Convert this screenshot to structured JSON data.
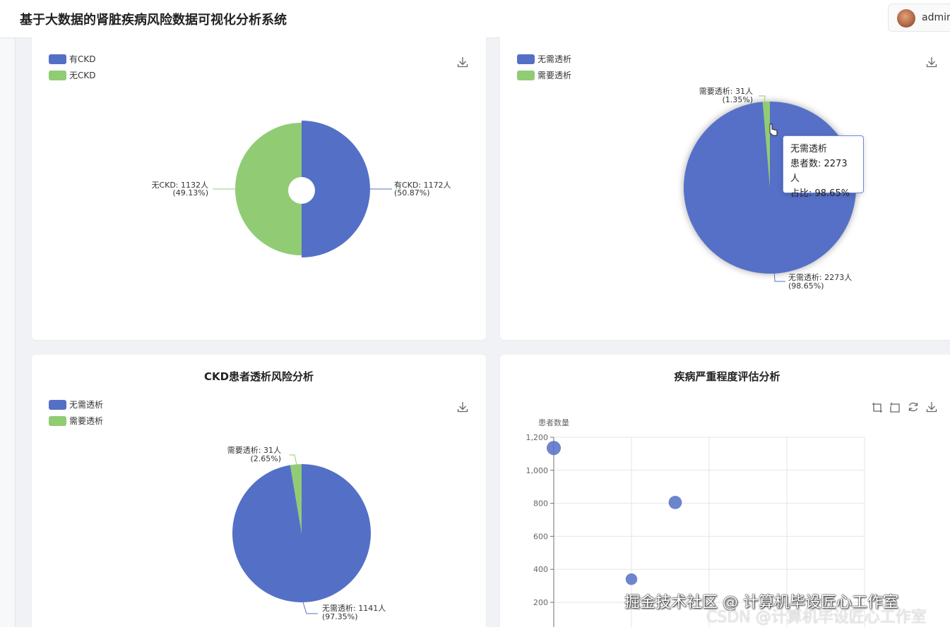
{
  "header": {
    "title": "基于大数据的肾脏疾病风险数据可视化分析系统",
    "username": "admin"
  },
  "watermark": {
    "main": "掘金技术社区 @ 计算机毕设匠心工作室",
    "sub": "CSDN @计算机毕设匠心工作室"
  },
  "colors": {
    "blue": "#5470c6",
    "green": "#91cc75"
  },
  "icons": {
    "download": "download-icon",
    "zoom": "zoom-icon",
    "zoom_back": "zoom-back-icon",
    "restore": "restore-icon"
  },
  "chart_data": [
    {
      "type": "pie",
      "variant": "rose-donut",
      "legend": [
        "有CKD",
        "无CKD"
      ],
      "legend_position": "top-left",
      "slices": [
        {
          "name": "有CKD",
          "value": 1172,
          "label": "有CKD: 1172人",
          "pct_label": "(50.87%)",
          "color": "#5470c6"
        },
        {
          "name": "无CKD",
          "value": 1132,
          "label": "无CKD: 1132人",
          "pct_label": "(49.13%)",
          "color": "#91cc75"
        }
      ]
    },
    {
      "type": "pie",
      "legend": [
        "无需透析",
        "需要透析"
      ],
      "legend_position": "top-left",
      "slices": [
        {
          "name": "无需透析",
          "value": 2273,
          "label": "无需透析: 2273人",
          "pct_label": "(98.65%)",
          "color": "#5470c6"
        },
        {
          "name": "需要透析",
          "value": 31,
          "label": "需要透析: 31人",
          "pct_label": "(1.35%)",
          "color": "#91cc75"
        }
      ],
      "tooltip": {
        "name": "无需透析",
        "count": "患者数: 2273人",
        "ratio": "占比: 98.65%"
      }
    },
    {
      "type": "pie",
      "title": "CKD患者透析风险分析",
      "legend": [
        "无需透析",
        "需要透析"
      ],
      "legend_position": "top-left",
      "slices": [
        {
          "name": "无需透析",
          "value": 1141,
          "label": "无需透析: 1141人",
          "pct_label": "(97.35%)",
          "color": "#5470c6"
        },
        {
          "name": "需要透析",
          "value": 31,
          "label": "需要透析: 31人",
          "pct_label": "(2.65%)",
          "color": "#91cc75"
        }
      ]
    },
    {
      "type": "scatter",
      "title": "疾病严重程度评估分析",
      "ylabel": "患者数量",
      "ylim": [
        0,
        1200
      ],
      "y_ticks": [
        "200",
        "400",
        "600",
        "800",
        "1,000",
        "1,200"
      ],
      "grid": true,
      "points": [
        {
          "x": 0,
          "y": 1135
        },
        {
          "x": 1,
          "y": 340
        },
        {
          "x": 2,
          "y": 805
        }
      ]
    }
  ]
}
